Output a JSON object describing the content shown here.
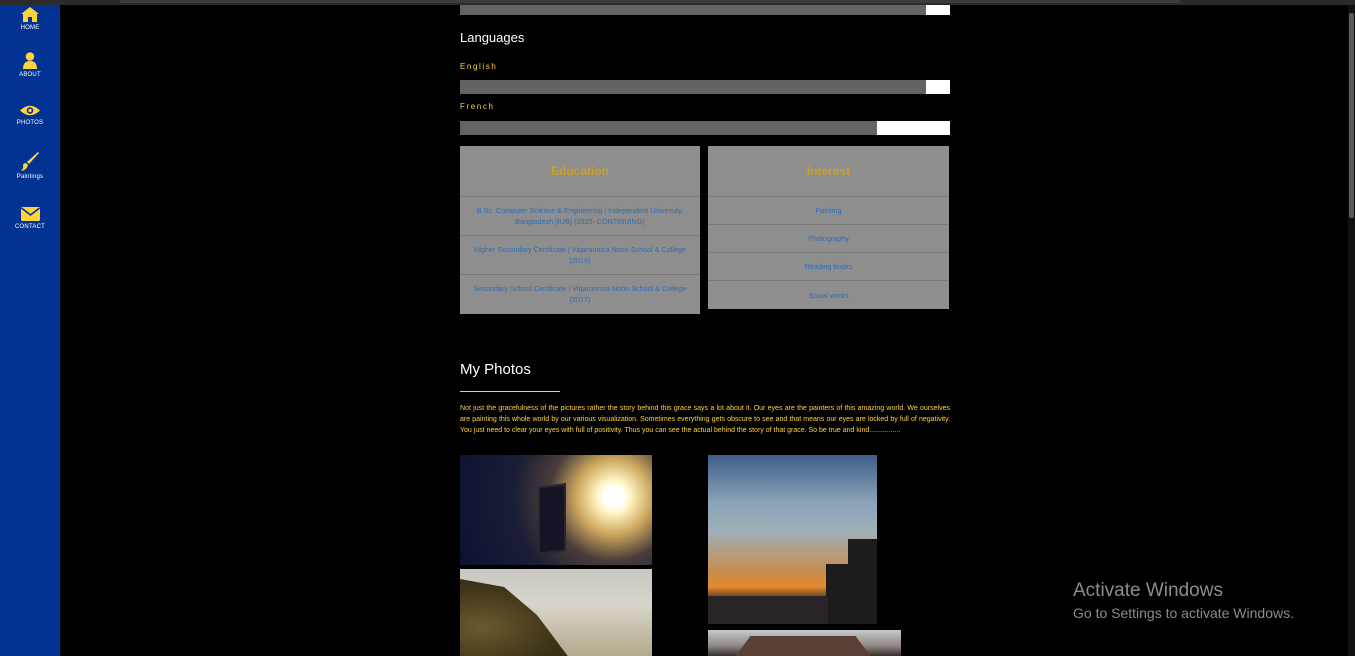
{
  "nav": {
    "items": [
      {
        "label": "HOME",
        "icon": "home-icon"
      },
      {
        "label": "ABOUT",
        "icon": "user-icon"
      },
      {
        "label": "PHOTOS",
        "icon": "eye-icon"
      },
      {
        "label": "Paintings",
        "icon": "paintbrush-icon"
      },
      {
        "label": "CONTACT",
        "icon": "envelope-icon"
      }
    ]
  },
  "skills": {
    "top_bar_level": 0.95
  },
  "languages": {
    "heading": "Languages",
    "items": [
      {
        "label": "English",
        "level": 0.95
      },
      {
        "label": "French",
        "level": 0.85
      }
    ]
  },
  "education": {
    "title": "Education",
    "rows": [
      "B.Sc. Computer Science & Engineering | Independent University, Bangladesh (IUB) (2020- CONTINUING)",
      "Higher Secondary Certificate | Viqarunnisa Noon School & College (2019)",
      "Secondary School Certificate | Viqarunnisa Noon School & College (2017)"
    ]
  },
  "interest": {
    "title": "Interest",
    "rows": [
      "Painting",
      "Photography",
      "Reading books",
      "Social works"
    ]
  },
  "photos": {
    "heading": "My Photos",
    "blurb": "Not just the gracefulness of the pictures rather the story behind this grace says a lot about it. Our eyes are the painters of this amazing world. We ourselves are painting this whole world by our various visualization. Sometimes everything gets obscure to see and that means our eyes are locked by full of negativity. You just need to clear your eyes with full of positivity. Thus you can see the actual behind the story of that grace. So be true and kind................"
  },
  "watermark": {
    "title": "Activate Windows",
    "subtitle": "Go to Settings to activate Windows."
  },
  "colors": {
    "sidebar": "#023393",
    "accent": "#ffd43b",
    "card": "#8e8e8e",
    "card_text": "#2f6cb3"
  }
}
